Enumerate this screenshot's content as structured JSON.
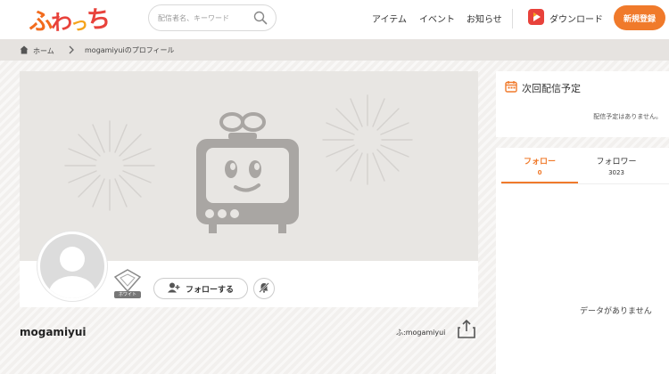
{
  "header": {
    "logo_chars": [
      "ふ",
      "わ",
      "っ",
      "ち"
    ],
    "search_placeholder": "配信者名、キーワード",
    "nav": [
      "アイテム",
      "イベント",
      "お知らせ"
    ],
    "download_label": "ダウンロード",
    "signup_label": "新規登録"
  },
  "breadcrumb": {
    "home": "ホーム",
    "current": "mogamiyuiのプロフィール"
  },
  "profile": {
    "username": "mogamiyui",
    "user_id": "ふ:mogamiyui",
    "badge_label": "ホワイト",
    "follow_button_label": "フォローする"
  },
  "schedule": {
    "title": "次回配信予定",
    "empty_text": "配信予定はありません。"
  },
  "follow_panel": {
    "tabs": [
      {
        "label": "フォロー",
        "count": "0"
      },
      {
        "label": "フォロワー",
        "count": "3023"
      }
    ],
    "empty_text": "データがありません"
  },
  "colors": {
    "accent": "#f07a2b",
    "cover_bg": "#e8e6e3",
    "mascot": "#a9a6a3"
  }
}
